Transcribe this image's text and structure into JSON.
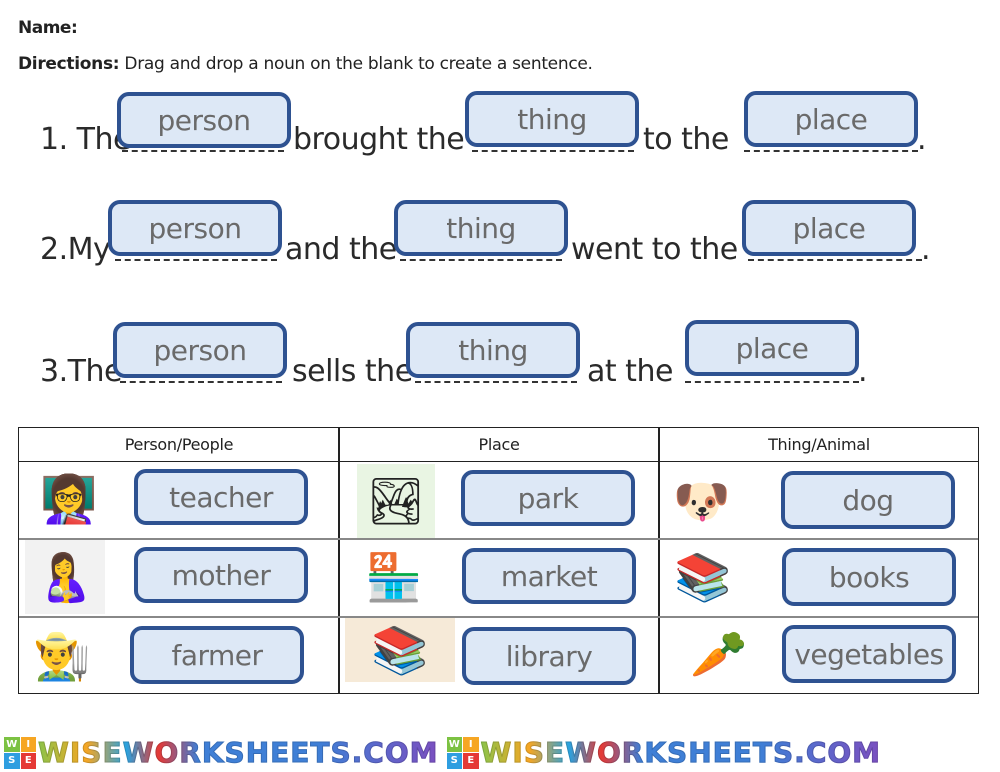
{
  "header": {
    "name_label": "Name:",
    "directions_label": "Directions:",
    "directions_text": " Drag and drop a noun on the blank to create a sentence."
  },
  "sentences": [
    {
      "parts": [
        "1.  The",
        "brought the",
        "to the",
        "."
      ],
      "chips": [
        "person",
        "thing",
        "place"
      ]
    },
    {
      "parts": [
        "2.My",
        "and the",
        "went to the",
        "."
      ],
      "chips": [
        "person",
        "thing",
        "place"
      ]
    },
    {
      "parts": [
        "3.The",
        "sells the",
        "at the",
        "."
      ],
      "chips": [
        "person",
        "thing",
        "place"
      ]
    }
  ],
  "table": {
    "headers": [
      "Person/People",
      "Place",
      "Thing/Animal"
    ],
    "columns": [
      [
        {
          "word": "teacher",
          "icon": "teacher-icon",
          "glyph": "👩‍🏫"
        },
        {
          "word": "mother",
          "icon": "mother-icon",
          "glyph": "🤱"
        },
        {
          "word": "farmer",
          "icon": "farmer-icon",
          "glyph": "👨‍🌾"
        }
      ],
      [
        {
          "word": "park",
          "icon": "park-icon",
          "glyph": "🏞"
        },
        {
          "word": "market",
          "icon": "market-icon",
          "glyph": "🏪"
        },
        {
          "word": "library",
          "icon": "library-icon",
          "glyph": "📚"
        }
      ],
      [
        {
          "word": "dog",
          "icon": "dog-icon",
          "glyph": "🐶"
        },
        {
          "word": "books",
          "icon": "books-icon",
          "glyph": "📚"
        },
        {
          "word": "vegetables",
          "icon": "vegetables-icon",
          "glyph": "🥕"
        }
      ]
    ]
  },
  "footer": {
    "brand": "WISEWORKSHEETS.COM",
    "logo_letters": [
      "W",
      "I",
      "S",
      "E"
    ]
  },
  "colors": {
    "chip_bg": "#dde8f6",
    "chip_border": "#2e5291",
    "chip_text": "#6a6a6a"
  }
}
